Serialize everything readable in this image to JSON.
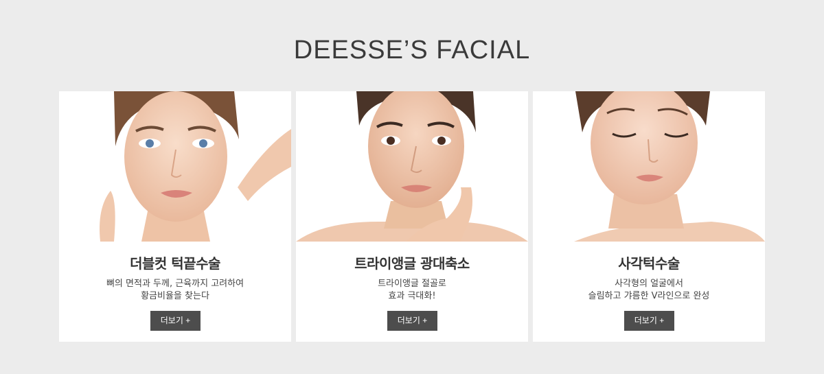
{
  "section": {
    "title": "DEESSE’S FACIAL"
  },
  "cards": [
    {
      "title": "더블컷 턱끝수술",
      "desc_line1": "뼈의 면적과 두께, 근육까지 고려하여",
      "desc_line2": "황금비율을 찾는다",
      "button": "더보기 +"
    },
    {
      "title": "트라이앵글 광대축소",
      "desc_line1": "트라이앵글 절골로",
      "desc_line2": "효과 극대화!",
      "button": "더보기 +"
    },
    {
      "title": "사각턱수술",
      "desc_line1": "사각형의 얼굴에서",
      "desc_line2": "슬림하고 갸름한 V라인으로 완성",
      "button": "더보기 +"
    }
  ],
  "colors": {
    "background": "#ececec",
    "card": "#ffffff",
    "button": "#4d4d4d",
    "skin": "#f3d2bd",
    "hair": "#6b4a35"
  }
}
